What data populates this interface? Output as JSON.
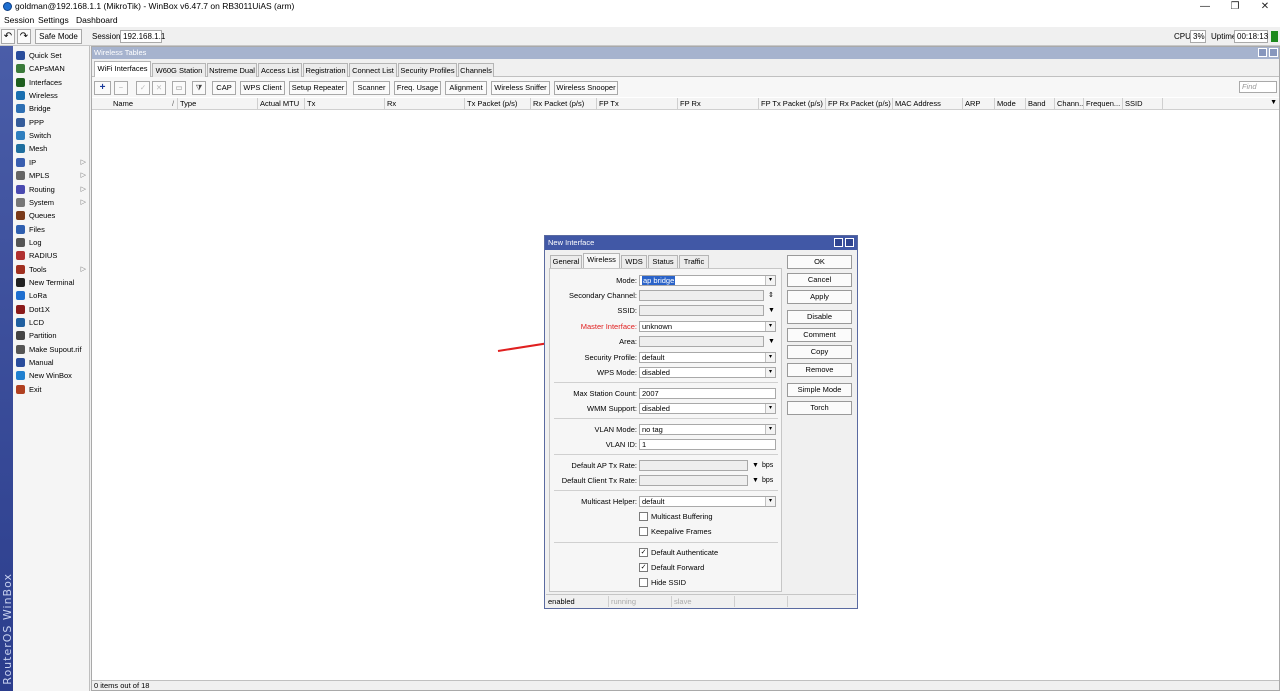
{
  "titlebar": {
    "title": "goldman@192.168.1.1 (MikroTik) - WinBox v6.47.7 on RB3011UiAS (arm)",
    "minimize": "—",
    "restore": "❐",
    "close": "✕"
  },
  "menu": [
    "Session",
    "Settings",
    "Dashboard"
  ],
  "toolbar": {
    "undo_icon": "↶",
    "redo_icon": "↷",
    "safe_mode": "Safe Mode",
    "session_label": "Session:",
    "session_value": "192.168.1.1",
    "cpu_label": "CPU:",
    "cpu_value": "3%",
    "uptime_label": "Uptime:",
    "uptime_value": "00:18:13"
  },
  "vertical_brand": "RouterOS WinBox",
  "sidebar": {
    "items": [
      {
        "label": "Quick Set",
        "icon": "wand-icon"
      },
      {
        "label": "CAPsMAN",
        "icon": "capsman-icon"
      },
      {
        "label": "Interfaces",
        "icon": "interfaces-icon"
      },
      {
        "label": "Wireless",
        "icon": "wireless-icon"
      },
      {
        "label": "Bridge",
        "icon": "bridge-icon"
      },
      {
        "label": "PPP",
        "icon": "ppp-icon"
      },
      {
        "label": "Switch",
        "icon": "switch-icon"
      },
      {
        "label": "Mesh",
        "icon": "mesh-icon"
      },
      {
        "label": "IP",
        "icon": "ip-icon",
        "arrow": "▷"
      },
      {
        "label": "MPLS",
        "icon": "mpls-icon",
        "arrow": "▷"
      },
      {
        "label": "Routing",
        "icon": "routing-icon",
        "arrow": "▷"
      },
      {
        "label": "System",
        "icon": "system-icon",
        "arrow": "▷"
      },
      {
        "label": "Queues",
        "icon": "queues-icon"
      },
      {
        "label": "Files",
        "icon": "files-icon"
      },
      {
        "label": "Log",
        "icon": "log-icon"
      },
      {
        "label": "RADIUS",
        "icon": "radius-icon"
      },
      {
        "label": "Tools",
        "icon": "tools-icon",
        "arrow": "▷"
      },
      {
        "label": "New Terminal",
        "icon": "terminal-icon"
      },
      {
        "label": "LoRa",
        "icon": "lora-icon"
      },
      {
        "label": "Dot1X",
        "icon": "dot1x-icon"
      },
      {
        "label": "LCD",
        "icon": "lcd-icon"
      },
      {
        "label": "Partition",
        "icon": "partition-icon"
      },
      {
        "label": "Make Supout.rif",
        "icon": "supout-icon"
      },
      {
        "label": "Manual",
        "icon": "manual-icon"
      },
      {
        "label": "New WinBox",
        "icon": "winbox-icon"
      },
      {
        "label": "Exit",
        "icon": "exit-icon"
      }
    ]
  },
  "wireless_tables": {
    "title": "Wireless Tables",
    "tabs": [
      "WiFi Interfaces",
      "W60G Station",
      "Nstreme Dual",
      "Access List",
      "Registration",
      "Connect List",
      "Security Profiles",
      "Channels"
    ],
    "buttons": [
      "CAP",
      "WPS Client",
      "Setup Repeater",
      "Scanner",
      "Freq. Usage",
      "Alignment",
      "Wireless Sniffer",
      "Wireless Snooper"
    ],
    "icon_buttons": {
      "add": "+",
      "remove": "−",
      "enable": "✓",
      "disable": "✕",
      "comment": "▭",
      "filter": "⧩"
    },
    "find_placeholder": "Find",
    "columns": [
      "Name",
      "Type",
      "Actual MTU",
      "Tx",
      "Rx",
      "Tx Packet (p/s)",
      "Rx Packet (p/s)",
      "FP Tx",
      "FP Rx",
      "FP Tx Packet (p/s)",
      "FP Rx Packet (p/s)",
      "MAC Address",
      "ARP",
      "Mode",
      "Band",
      "Chann...",
      "Frequen...",
      "SSID"
    ],
    "sort_marker": "/",
    "status": "0 items out of 18"
  },
  "dialog": {
    "title": "New Interface",
    "tabs": [
      "General",
      "Wireless",
      "WDS",
      "Status",
      "Traffic"
    ],
    "fields": {
      "mode": {
        "label": "Mode:",
        "value": "ap bridge"
      },
      "secondary_channel": {
        "label": "Secondary Channel:",
        "value": ""
      },
      "ssid": {
        "label": "SSID:",
        "value": ""
      },
      "master_interface": {
        "label": "Master Interface:",
        "value": "unknown"
      },
      "area": {
        "label": "Area:",
        "value": ""
      },
      "security_profile": {
        "label": "Security Profile:",
        "value": "default"
      },
      "wps_mode": {
        "label": "WPS Mode:",
        "value": "disabled"
      },
      "max_station_count": {
        "label": "Max Station Count:",
        "value": "2007"
      },
      "wmm_support": {
        "label": "WMM Support:",
        "value": "disabled"
      },
      "vlan_mode": {
        "label": "VLAN Mode:",
        "value": "no tag"
      },
      "vlan_id": {
        "label": "VLAN ID:",
        "value": "1"
      },
      "default_ap_tx_rate": {
        "label": "Default AP Tx Rate:",
        "value": "",
        "unit": "bps"
      },
      "default_client_tx_rate": {
        "label": "Default Client Tx Rate:",
        "value": "",
        "unit": "bps"
      },
      "multicast_helper": {
        "label": "Multicast Helper:",
        "value": "default"
      }
    },
    "checkboxes": {
      "multicast_buffering": {
        "label": "Multicast Buffering",
        "checked": false
      },
      "keepalive_frames": {
        "label": "Keepalive Frames",
        "checked": false
      },
      "default_authenticate": {
        "label": "Default Authenticate",
        "checked": true
      },
      "default_forward": {
        "label": "Default Forward",
        "checked": true
      },
      "hide_ssid": {
        "label": "Hide SSID",
        "checked": false
      }
    },
    "buttons": [
      "OK",
      "Cancel",
      "Apply",
      "Disable",
      "Comment",
      "Copy",
      "Remove",
      "Simple Mode",
      "Torch"
    ],
    "status": [
      "enabled",
      "running",
      "slave",
      ""
    ],
    "highlight_color": "#e02020",
    "accent_color": "#4158a6"
  }
}
